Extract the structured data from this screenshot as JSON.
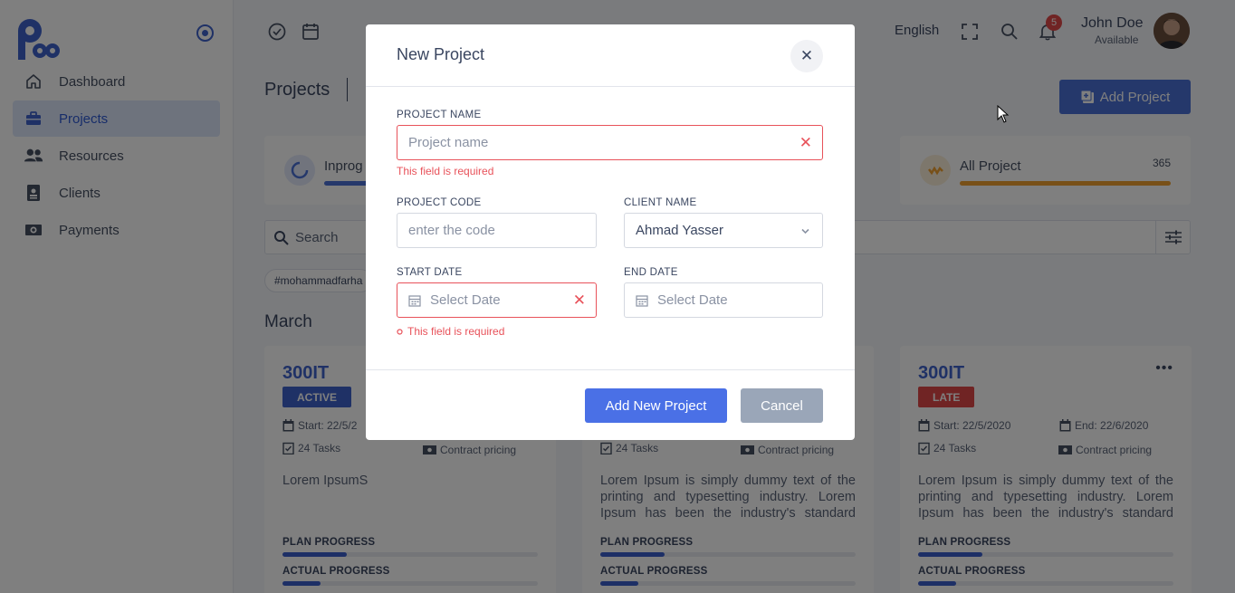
{
  "sidebar": {
    "items": [
      {
        "label": "Dashboard",
        "icon": "home-icon"
      },
      {
        "label": "Projects",
        "icon": "briefcase-icon",
        "active": true
      },
      {
        "label": "Resources",
        "icon": "users-icon"
      },
      {
        "label": "Clients",
        "icon": "id-badge-icon"
      },
      {
        "label": "Payments",
        "icon": "money-icon"
      }
    ]
  },
  "header": {
    "language": "English",
    "notification_count": "5",
    "user_name": "John Doe",
    "user_status": "Available"
  },
  "page": {
    "title": "Projects",
    "add_project_label": "Add Project",
    "search_placeholder": "Search",
    "tag": "#mohammadfarha",
    "month": "March"
  },
  "stats": [
    {
      "label": "Inprog",
      "color": "#4a70d6"
    },
    {
      "label": "All Project",
      "count": "365",
      "color": "#f0a030",
      "progress": 1.0
    }
  ],
  "cards": [
    {
      "title": "300IT",
      "status": "ACTIVE",
      "status_color": "#3f63cc",
      "start": "Start: 22/5/2",
      "tasks": "24 Tasks",
      "pricing": "Contract pricing",
      "desc": "Lorem IpsumS",
      "plan_progress": 0.25,
      "actual_progress": 0.15
    },
    {
      "tasks": "24 Tasks",
      "pricing": "Contract pricing",
      "desc": "Lorem Ipsum is simply dummy text of the printing and typesetting industry. Lorem Ipsum has been the industry's standard dummy text",
      "plan_progress": 0.25,
      "actual_progress": 0.15
    },
    {
      "title": "300IT",
      "status": "LATE",
      "status_color": "#e04848",
      "start": "Start: 22/5/2020",
      "end": "End: 22/6/2020",
      "tasks": "24 Tasks",
      "pricing": "Contract pricing",
      "desc": "Lorem Ipsum is simply dummy text of the printing and typesetting industry. Lorem Ipsum has been the industry's standard dummy text",
      "plan_progress": 0.25,
      "actual_progress": 0.15
    }
  ],
  "card_labels": {
    "plan": "PLAN PROGRESS",
    "actual": "ACTUAL PROGRESS"
  },
  "modal": {
    "title": "New Project",
    "project_name_label": "PROJECT NAME",
    "project_name_placeholder": "Project name",
    "project_name_error": "This field is required",
    "project_code_label": "PROJECT CODE",
    "project_code_placeholder": "enter the code",
    "client_name_label": "CLIENT NAME",
    "client_name_value": "Ahmad Yasser",
    "start_date_label": "START DATE",
    "start_date_placeholder": "Select Date",
    "start_date_error": "This field is required",
    "end_date_label": "END DATE",
    "end_date_placeholder": "Select Date",
    "submit_label": "Add New Project",
    "cancel_label": "Cancel"
  }
}
